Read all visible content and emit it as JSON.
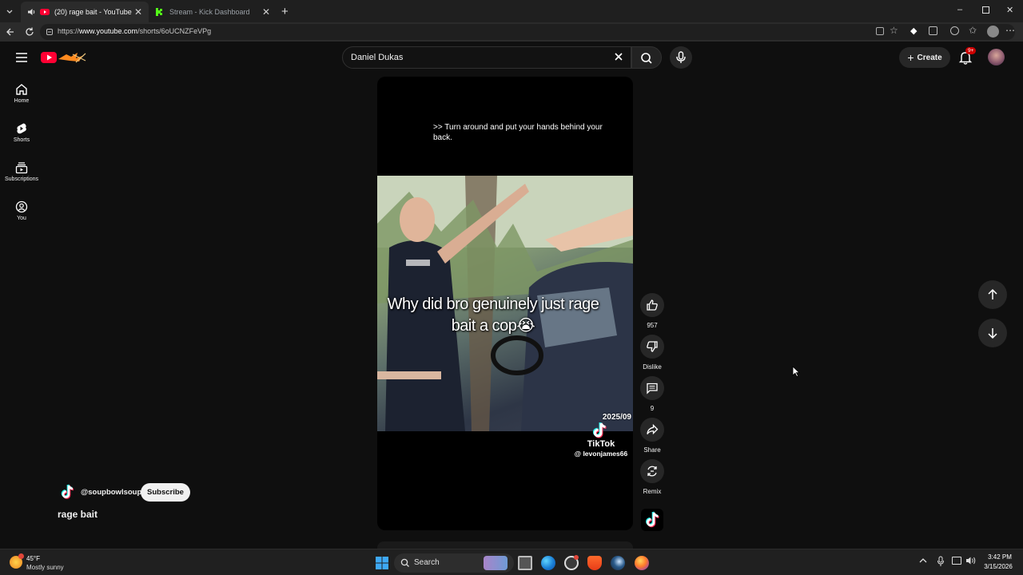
{
  "browser": {
    "tabs": [
      {
        "label": "(20) rage bait - YouTube",
        "active": true,
        "favicon": "youtube-icon"
      },
      {
        "label": "Stream - Kick Dashboard",
        "active": false,
        "favicon": "kick-icon"
      }
    ],
    "url_prefix": "https://",
    "url_host": "www.youtube.com",
    "url_path": "/shorts/6oUCNZFeVPg"
  },
  "youtube": {
    "search_value": "Daniel Dukas",
    "create_label": "Create",
    "notifications_badge": "9+",
    "nav": [
      {
        "label": "Home",
        "icon": "home-icon"
      },
      {
        "label": "Shorts",
        "icon": "shorts-icon"
      },
      {
        "label": "Subscriptions",
        "icon": "subscriptions-icon"
      },
      {
        "label": "You",
        "icon": "you-icon"
      }
    ]
  },
  "short": {
    "caption": ">> Turn around and put your hands behind your back.",
    "overlay_text": "Why did bro genuinely just rage bait a cop😭",
    "date_stamp": "2025/09",
    "watermark_brand": "TikTok",
    "watermark_handle": "@ levonjames66",
    "channel_handle": "@soupbowlsoup",
    "subscribe_label": "Subscribe",
    "title": "rage bait"
  },
  "actions": {
    "like_count": "957",
    "dislike_label": "Dislike",
    "comment_count": "9",
    "share_label": "Share",
    "remix_label": "Remix"
  },
  "taskbar": {
    "weather_temp": "45°F",
    "weather_desc": "Mostly sunny",
    "search_label": "Search",
    "time": "3:42 PM",
    "date": "3/15/2026"
  },
  "colors": {
    "youtube_red": "#ff0033",
    "background": "#0f0f0f",
    "kick_green": "#53fc18"
  }
}
